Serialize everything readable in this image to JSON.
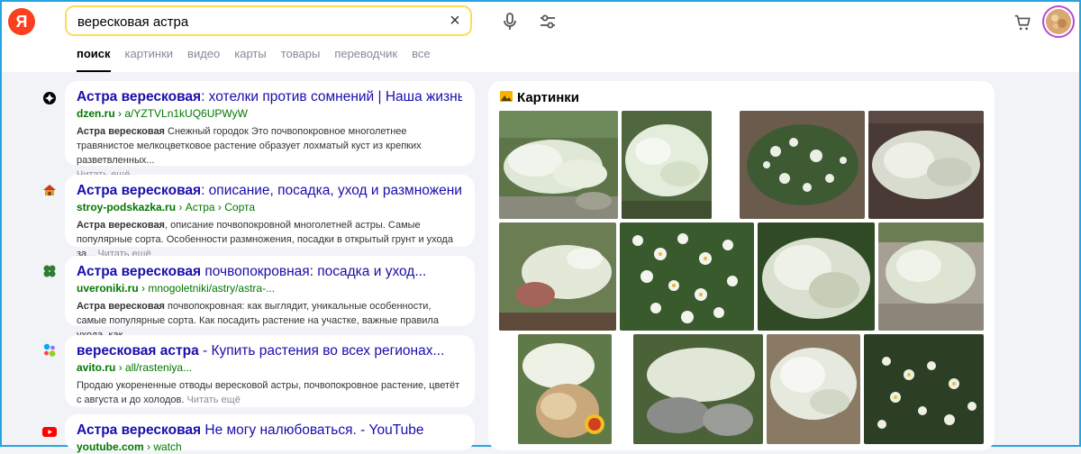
{
  "header": {
    "logo_letter": "Я",
    "search_value": "вересковая астра",
    "clear_label": "×"
  },
  "tabs": [
    "поиск",
    "картинки",
    "видео",
    "карты",
    "товары",
    "переводчик",
    "все"
  ],
  "results": [
    {
      "title_bold": "Астра вересковая",
      "title_rest": ": хотелки против сомнений | Наша жизнь",
      "host": "dzen.ru",
      "path": "a/YZTVLn1kUQ6UPWyW",
      "snippet_bold": "Астра вересковая",
      "snippet": " Снежный городок Это почвопокровное многолетнее травянистое мелкоцветковое растение образует лохматый куст из крепких разветвленных...",
      "more": "Читать ещё"
    },
    {
      "title_bold": "Астра вересковая",
      "title_rest": ": описание, посадка, уход и размножение",
      "host": "stroy-podskazka.ru",
      "path": "Астра › Сорта",
      "snippet_bold": "Астра вересковая",
      "snippet": ", описание почвопокровной многолетней астры. Самые популярные сорта. Особенности размножения, посадки в открытый грунт и ухода за...",
      "more": "Читать ещё"
    },
    {
      "title_bold": "Астра вересковая",
      "title_rest": " почвопокровная: посадка и уход...",
      "host": "uveroniki.ru",
      "path": "mnogoletniki/astry/astra-...",
      "snippet_bold": "Астра вересковая",
      "snippet": " почвопокровная: как выглядит, уникальные особенности, самые популярные сорта. Как посадить растение на участке, важные правила ухода, как...",
      "more": ""
    },
    {
      "title_bold": "вересковая астра",
      "title_rest": " - Купить растения во всех регионах...",
      "host": "avito.ru",
      "path": "all/rasteniya...",
      "snippet_bold": "",
      "snippet": "Продаю укорененные отводы вересковой астры, почвопокровное растение, цветёт с августа и до холодов.",
      "more": "Читать ещё"
    },
    {
      "title_bold": "Астра вересковая",
      "title_rest": " Не могу налюбоваться. - YouTube",
      "host": "youtube.com",
      "path": "watch",
      "snippet_bold": "",
      "snippet": "",
      "more": ""
    }
  ],
  "images": {
    "title": "Картинки"
  },
  "colors": {
    "accent_yellow": "#fddd5c",
    "logo_red": "#fc3f1d",
    "link_blue": "#1a0dab",
    "url_green": "#007700"
  }
}
